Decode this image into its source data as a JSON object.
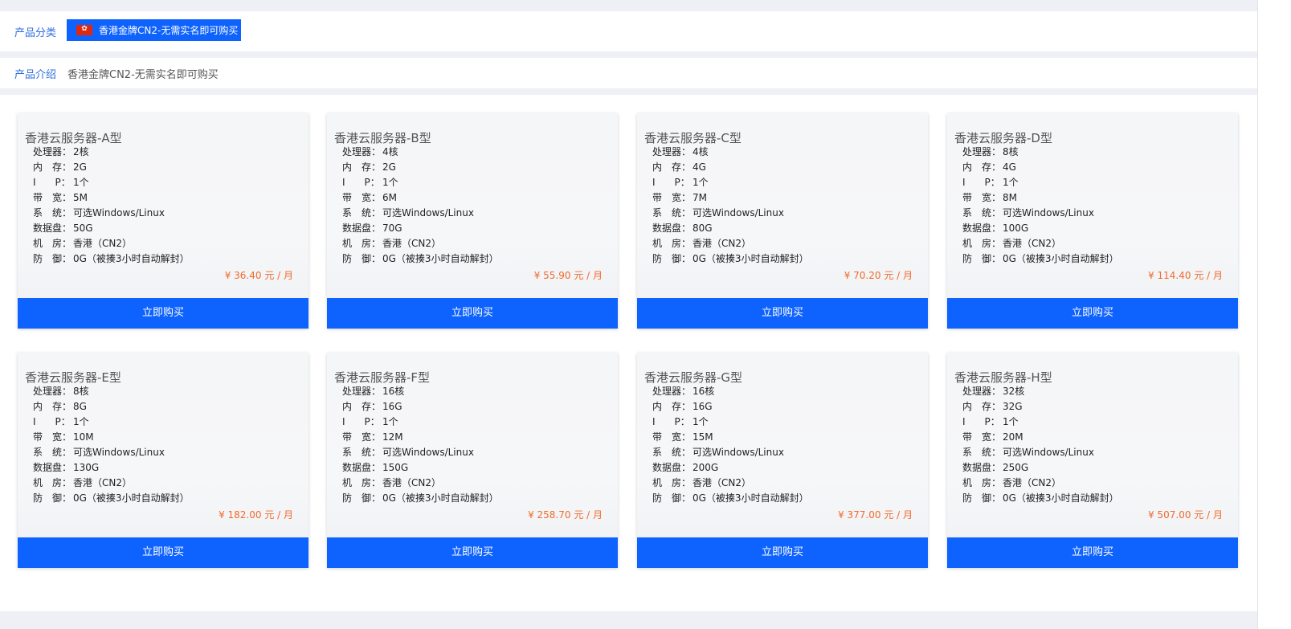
{
  "category": {
    "label": "产品分类",
    "selected": "香港金牌CN2-无需实名即可购买",
    "flag_icon": "hong-kong-flag-icon"
  },
  "intro": {
    "label": "产品介绍",
    "text": "香港金牌CN2-无需实名即可购买"
  },
  "spec_labels": {
    "cpu": "处理器：",
    "ram": "内　存：",
    "ip": "I　　P：",
    "bandwidth": "带　宽：",
    "os": "系　统：",
    "disk": "数据盘：",
    "room": "机　房：",
    "defense": "防　御："
  },
  "buy_label": "立即购买",
  "accent_color": "#0e62fe",
  "price_color": "#f26a2b",
  "products": [
    {
      "name": "香港云服务器-A型",
      "cpu": "2核",
      "ram": "2G",
      "ip": "1个",
      "bandwidth": "5M",
      "os": "可选Windows/Linux",
      "disk": "50G",
      "room": "香港（CN2）",
      "defense": "0G（被揍3小时自动解封）",
      "price": "¥ 36.40 元 / 月"
    },
    {
      "name": "香港云服务器-B型",
      "cpu": "4核",
      "ram": "2G",
      "ip": "1个",
      "bandwidth": "6M",
      "os": "可选Windows/Linux",
      "disk": "70G",
      "room": "香港（CN2）",
      "defense": "0G（被揍3小时自动解封）",
      "price": "¥ 55.90 元 / 月"
    },
    {
      "name": "香港云服务器-C型",
      "cpu": "4核",
      "ram": "4G",
      "ip": "1个",
      "bandwidth": "7M",
      "os": "可选Windows/Linux",
      "disk": "80G",
      "room": "香港（CN2）",
      "defense": "0G（被揍3小时自动解封）",
      "price": "¥ 70.20 元 / 月"
    },
    {
      "name": "香港云服务器-D型",
      "cpu": "8核",
      "ram": "4G",
      "ip": "1个",
      "bandwidth": "8M",
      "os": "可选Windows/Linux",
      "disk": "100G",
      "room": "香港（CN2）",
      "defense": "0G（被揍3小时自动解封）",
      "price": "¥ 114.40 元 / 月"
    },
    {
      "name": "香港云服务器-E型",
      "cpu": "8核",
      "ram": "8G",
      "ip": "1个",
      "bandwidth": "10M",
      "os": "可选Windows/Linux",
      "disk": "130G",
      "room": "香港（CN2）",
      "defense": "0G（被揍3小时自动解封）",
      "price": "¥ 182.00 元 / 月"
    },
    {
      "name": "香港云服务器-F型",
      "cpu": "16核",
      "ram": "16G",
      "ip": "1个",
      "bandwidth": "12M",
      "os": "可选Windows/Linux",
      "disk": "150G",
      "room": "香港（CN2）",
      "defense": "0G（被揍3小时自动解封）",
      "price": "¥ 258.70 元 / 月"
    },
    {
      "name": "香港云服务器-G型",
      "cpu": "16核",
      "ram": "16G",
      "ip": "1个",
      "bandwidth": "15M",
      "os": "可选Windows/Linux",
      "disk": "200G",
      "room": "香港（CN2）",
      "defense": "0G（被揍3小时自动解封）",
      "price": "¥ 377.00 元 / 月"
    },
    {
      "name": "香港云服务器-H型",
      "cpu": "32核",
      "ram": "32G",
      "ip": "1个",
      "bandwidth": "20M",
      "os": "可选Windows/Linux",
      "disk": "250G",
      "room": "香港（CN2）",
      "defense": "0G（被揍3小时自动解封）",
      "price": "¥ 507.00 元 / 月"
    }
  ]
}
